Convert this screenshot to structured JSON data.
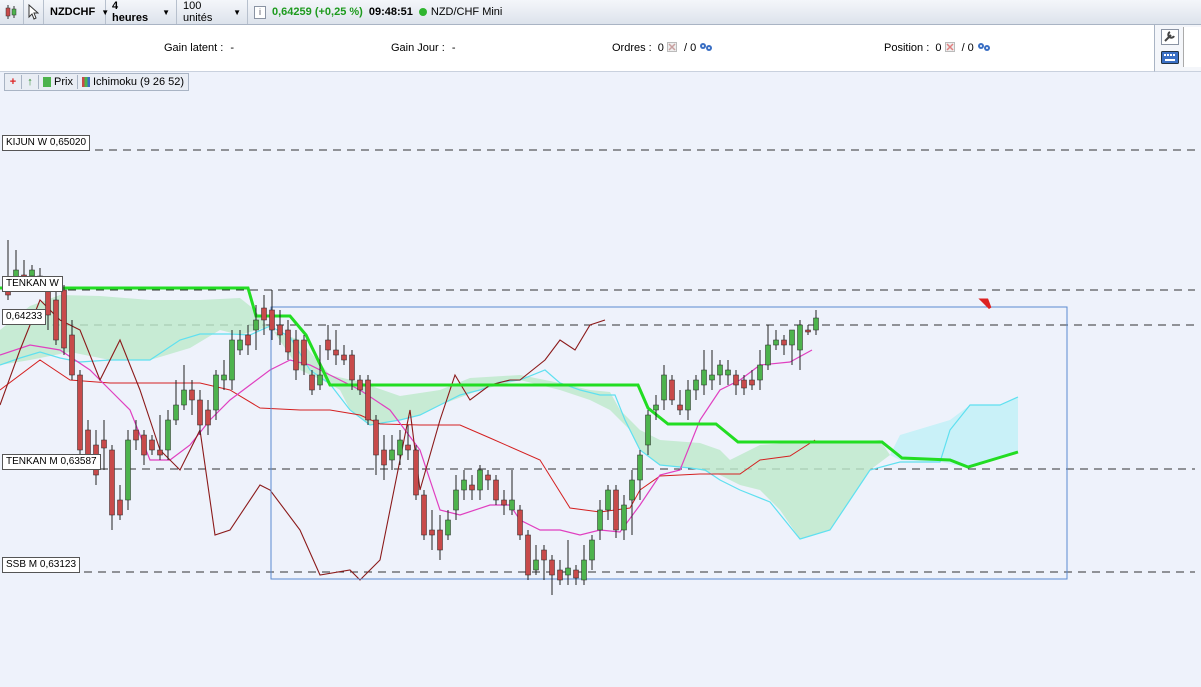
{
  "toolbar": {
    "symbol": "NZDCHF",
    "timeframe": "4 heures",
    "quantity": "100 unités",
    "info_icon": "i",
    "price_change": "0,64259 (+0,25 %)",
    "time": "09:48:51",
    "instrument": "NZD/CHF Mini"
  },
  "infobar": {
    "gain_latent_label": "Gain latent :",
    "gain_latent_value": "-",
    "gain_jour_label": "Gain Jour :",
    "gain_jour_value": "-",
    "ordres_label": "Ordres :",
    "ordres_a": "0",
    "ordres_b": "/ 0",
    "position_label": "Position :",
    "position_a": "0",
    "position_b": "/ 0"
  },
  "legend": {
    "add": "+",
    "up": "↑",
    "price": "Prix",
    "ichimoku": "Ichimoku (9 26 52)"
  },
  "levels": {
    "kijun_w": "KIJUN W 0,65020",
    "tenkan_w": "TENKAN W",
    "current": "0,64233",
    "tenkan_m": "TENKAN M 0,63587",
    "ssb_m": "SSB M 0,63123"
  },
  "icons": {
    "chart_type": "candlestick-icon",
    "cursor": "cursor-icon",
    "settings": "gear-icon",
    "cancel": "cancel-icon",
    "tools": "wrench-icon",
    "keyboard": "keyboard-icon",
    "alert": "red-arrow-icon"
  },
  "colors": {
    "bull": "#4db34d",
    "bear": "#c84a4a",
    "kijun": "#22dd22",
    "tenkan": "#e040c0",
    "chikou": "#8b1a1a",
    "ssa": "#5fe0f0",
    "ssb_red": "#d42020"
  }
}
